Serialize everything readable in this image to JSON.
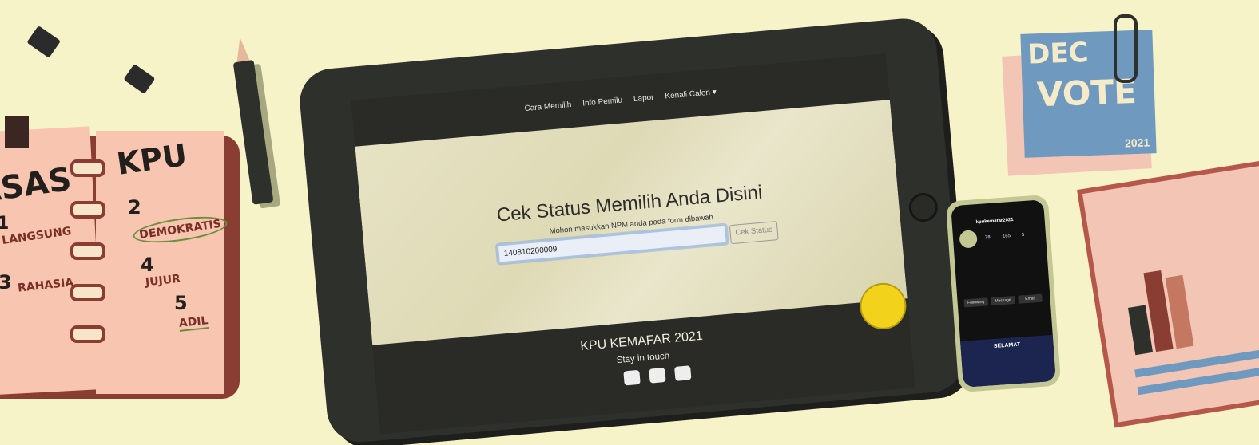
{
  "notebook": {
    "heading_left": "ASAS",
    "heading_right": "KPU",
    "items": [
      {
        "num": "1",
        "label": "LANGSUNG"
      },
      {
        "num": "2",
        "label": "DEMOKRATIS"
      },
      {
        "num": "3",
        "label": "RAHASIA"
      },
      {
        "num": "4",
        "label": "JUJUR"
      },
      {
        "num": "5",
        "label": "ADIL"
      }
    ]
  },
  "nav": {
    "items": [
      "Cara Memilih",
      "Info Pemilu",
      "Lapor",
      "Kenali Calon"
    ]
  },
  "hero": {
    "title": "Cek Status Memilih Anda Disini",
    "subtitle": "Mohon masukkan NPM anda pada form dibawah",
    "input_value": "140810200009",
    "button_label": "Cek Status"
  },
  "footer": {
    "title": "KPU KEMAFAR 2021",
    "subtitle": "Stay in touch"
  },
  "phone": {
    "account": "kpukemafar2021",
    "posts": "78",
    "followers": "165",
    "following": "5",
    "follow_button": "Following",
    "message_button": "Message",
    "email_button": "Email",
    "banner": "SELAMAT"
  },
  "sticky_note": {
    "line1": "DEC",
    "line2": "VOTE",
    "year": "2021"
  },
  "colors": {
    "background": "#f7f3c9",
    "tablet": "#2e302c",
    "accent": "#f2d21b"
  }
}
